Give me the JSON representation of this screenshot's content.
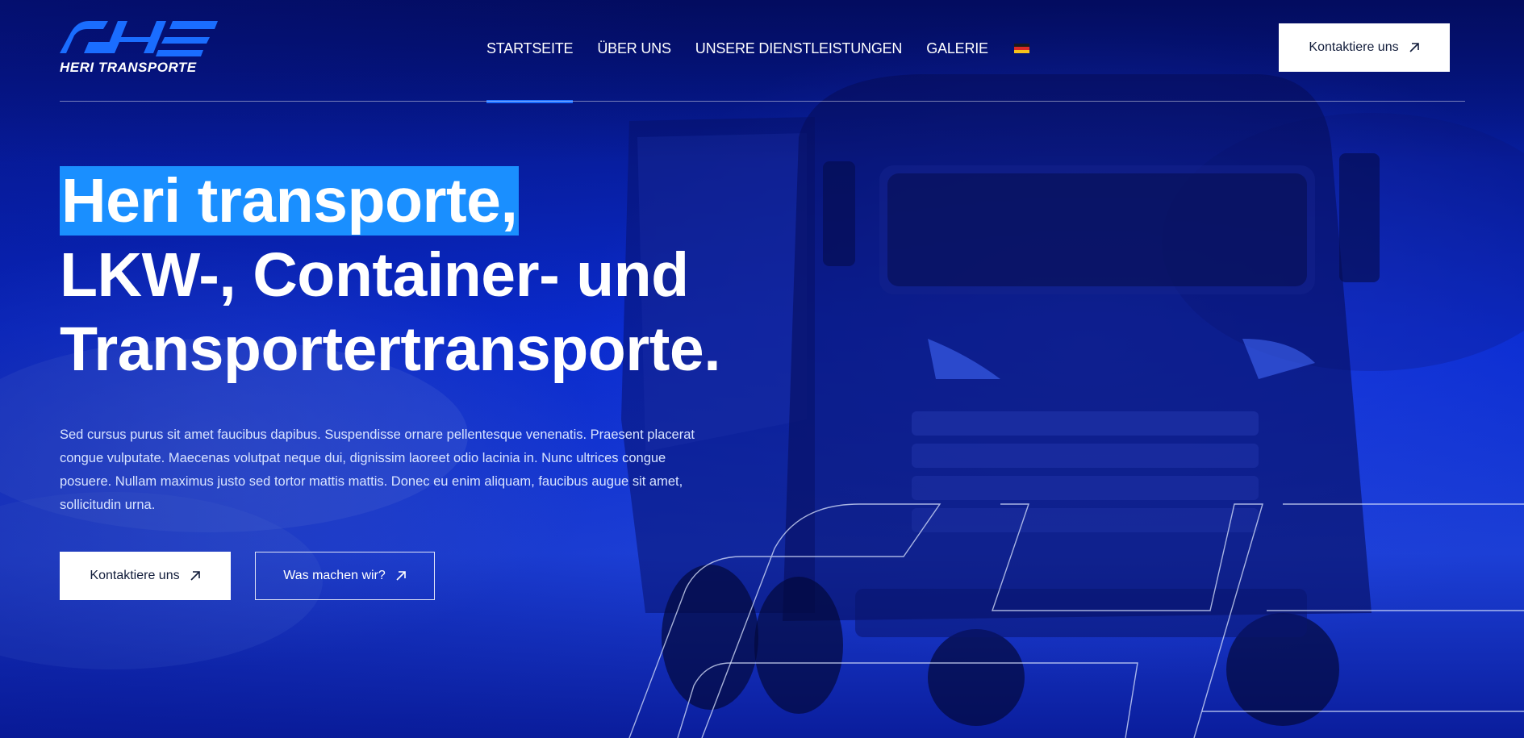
{
  "brand": {
    "name": "HERI TRANSPORTE",
    "accent": "#1a6dff",
    "highlight": "#1a8fff"
  },
  "nav": {
    "items": [
      {
        "label": "STARTSEITE",
        "active": true
      },
      {
        "label": "ÜBER UNS",
        "active": false
      },
      {
        "label": "UNSERE DIENSTLEISTUNGEN",
        "active": false
      },
      {
        "label": "GALERIE",
        "active": false
      }
    ],
    "language_icon": "german-flag-icon"
  },
  "header": {
    "cta_label": "Kontaktiere uns",
    "cta_icon": "arrow-up-right-icon"
  },
  "hero": {
    "title_highlight": "Heri transporte,",
    "title_line2": "LKW-, Container- und",
    "title_line3": "Transportertransporte.",
    "description": "Sed cursus purus sit amet faucibus dapibus. Suspendisse ornare pellentesque venenatis. Praesent placerat congue vulputate. Maecenas volutpat neque dui, dignissim laoreet odio lacinia in. Nunc ultrices congue posuere. Nullam maximus justo sed tortor mattis mattis. Donec eu enim aliquam, faucibus augue sit amet, sollicitudin urna.",
    "primary_button": "Kontaktiere uns",
    "secondary_button": "Was machen wir?",
    "background": "truck-photo-blue-tint",
    "watermark": "heri-logo-outline"
  }
}
